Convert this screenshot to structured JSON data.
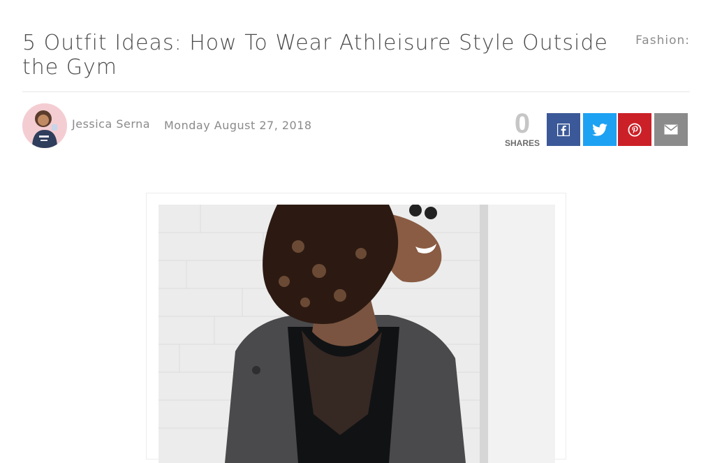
{
  "article": {
    "title": "5 Outfit Ideas: How To Wear Athleisure Style Outside the Gym",
    "category": "Fashion:",
    "author": "Jessica Serna",
    "date": "Monday August 27, 2018"
  },
  "shares": {
    "count": "0",
    "label": "SHARES"
  },
  "share_buttons": [
    {
      "icon": "facebook-icon",
      "color": "#3b5998"
    },
    {
      "icon": "twitter-icon",
      "color": "#1da1f2"
    },
    {
      "icon": "pinterest-icon",
      "color": "#cb2027"
    },
    {
      "icon": "email-icon",
      "color": "#8b8b8b"
    }
  ],
  "colors": {
    "title": "#4b4b4b",
    "meta": "#8a8a8a",
    "divider": "#e8e8e8"
  }
}
